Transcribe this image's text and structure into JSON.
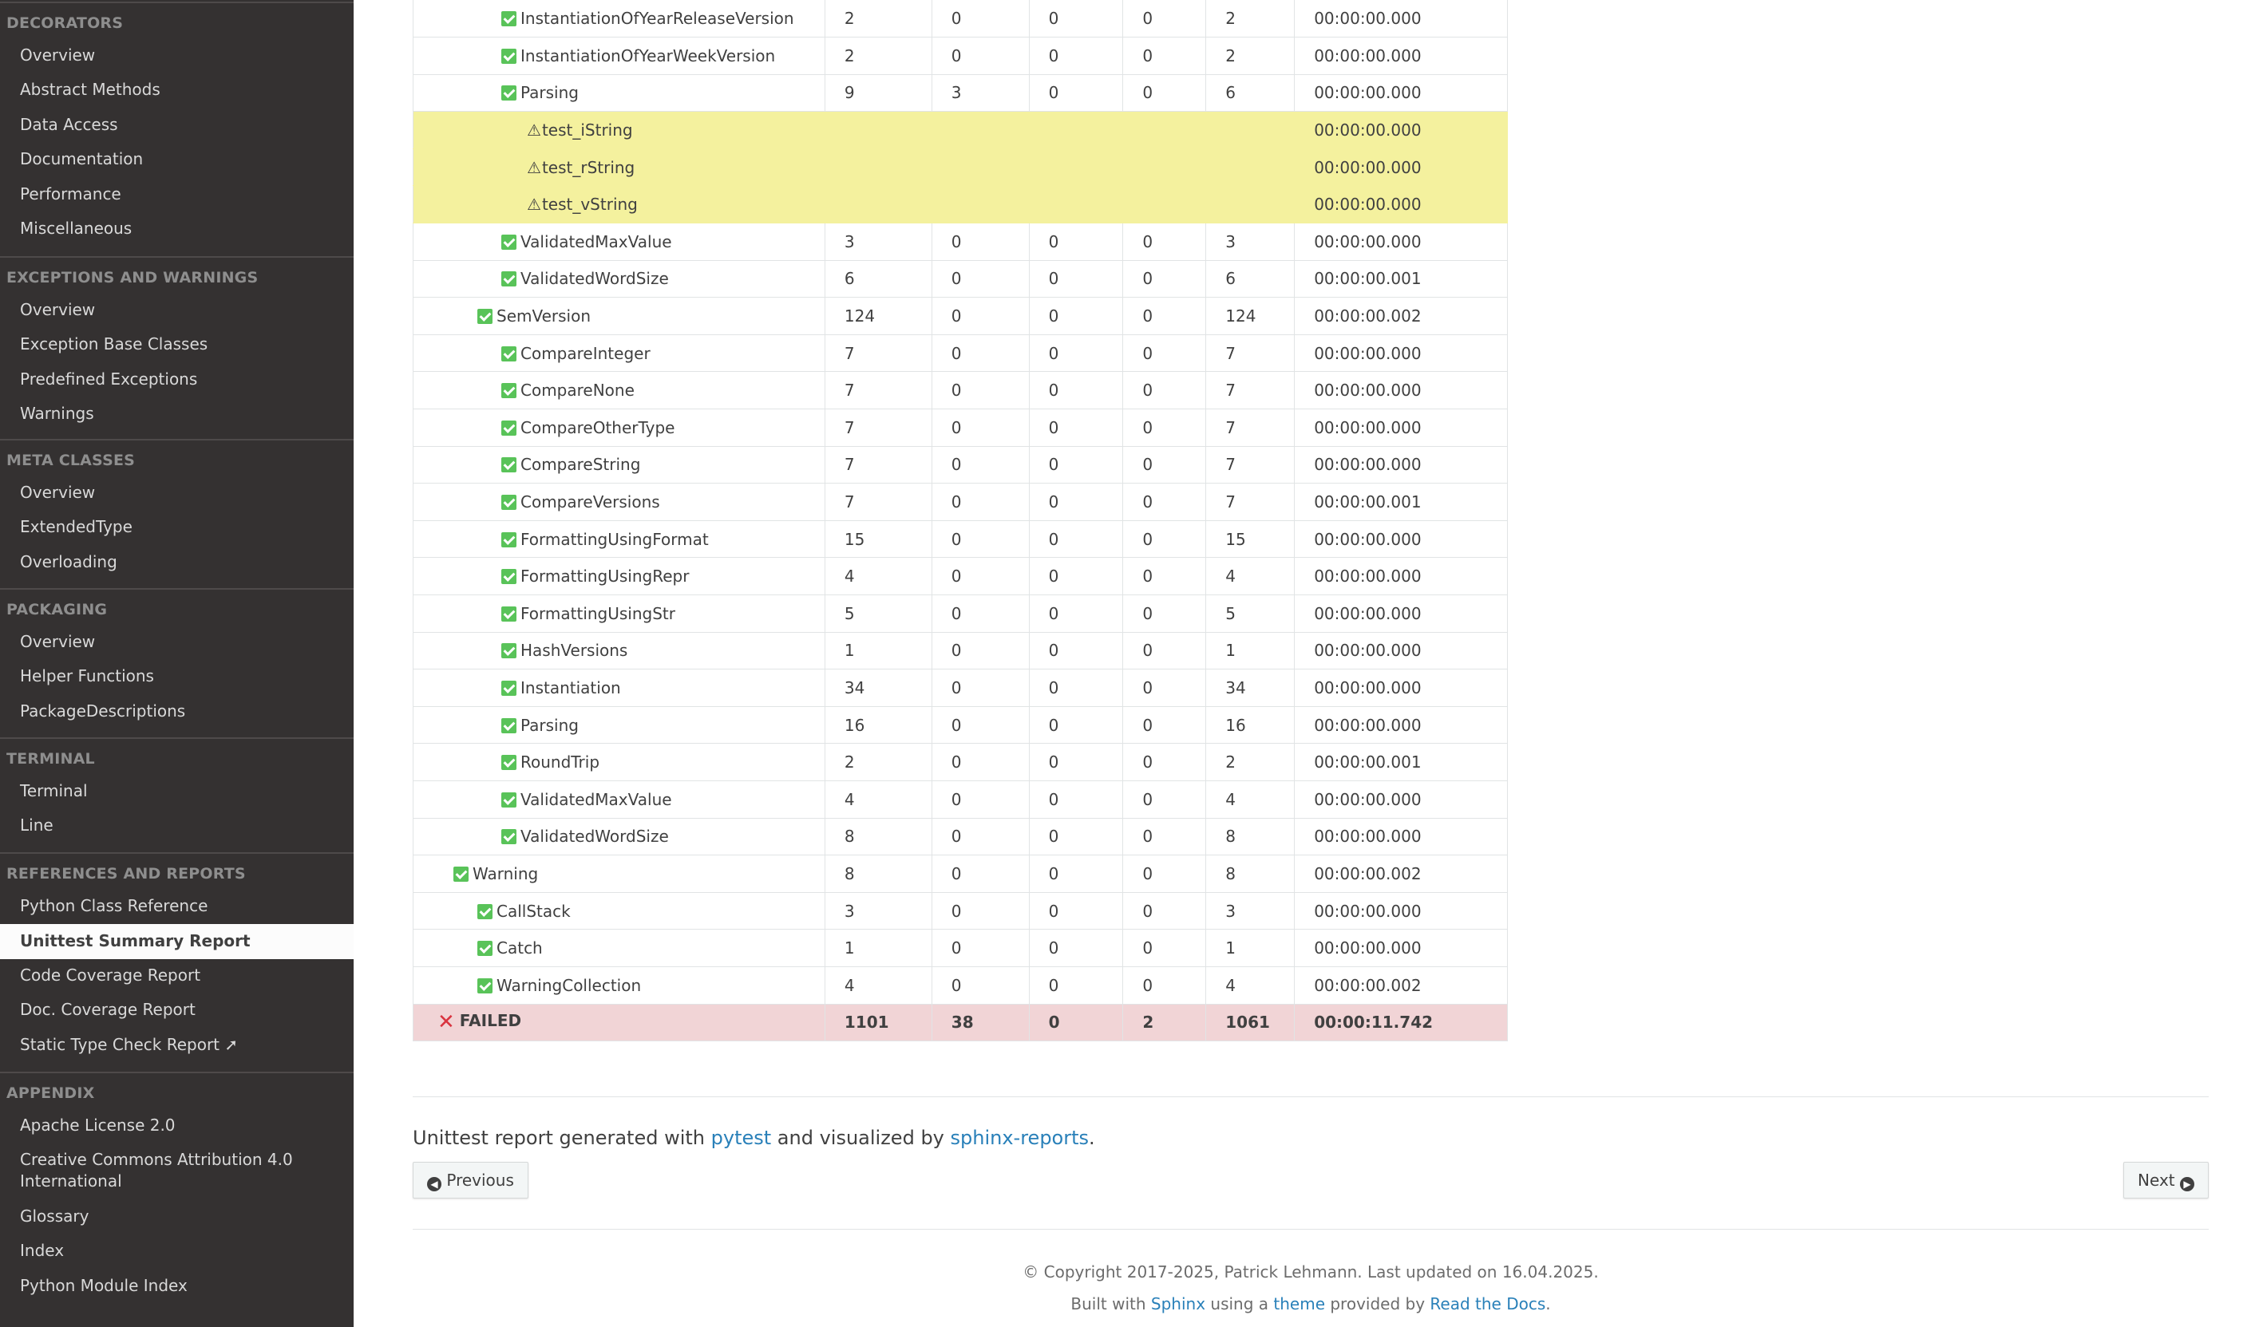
{
  "sidebar": {
    "sections": [
      {
        "caption": "DECORATORS",
        "items": [
          "Overview",
          "Abstract Methods",
          "Data Access",
          "Documentation",
          "Performance",
          "Miscellaneous"
        ]
      },
      {
        "caption": "EXCEPTIONS AND WARNINGS",
        "items": [
          "Overview",
          "Exception Base Classes",
          "Predefined Exceptions",
          "Warnings"
        ]
      },
      {
        "caption": "META CLASSES",
        "items": [
          "Overview",
          "ExtendedType",
          "Overloading"
        ]
      },
      {
        "caption": "PACKAGING",
        "items": [
          "Overview",
          "Helper Functions",
          "PackageDescriptions"
        ]
      },
      {
        "caption": "TERMINAL",
        "items": [
          "Terminal",
          "Line"
        ]
      },
      {
        "caption": "REFERENCES AND REPORTS",
        "items": [
          "Python Class Reference",
          "Unittest Summary Report",
          "Code Coverage Report",
          "Doc. Coverage Report",
          "Static Type Check Report ➚"
        ]
      },
      {
        "caption": "APPENDIX",
        "items": [
          "Apache License 2.0",
          "Creative Commons Attribution 4.0 International",
          "Glossary",
          "Index",
          "Python Module Index"
        ]
      }
    ],
    "current_item": "Unittest Summary Report"
  },
  "table": {
    "rows": [
      {
        "name": "InstantiationOfYearReleaseVersion",
        "status": "passed",
        "tests": "2",
        "skipped": "0",
        "errored": "0",
        "failed": "0",
        "passed": "2",
        "duration": "00:00:00.000"
      },
      {
        "name": "InstantiationOfYearWeekVersion",
        "status": "passed",
        "tests": "2",
        "skipped": "0",
        "errored": "0",
        "failed": "0",
        "passed": "2",
        "duration": "00:00:00.000"
      },
      {
        "name": "Parsing",
        "status": "passed",
        "tests": "9",
        "skipped": "3",
        "errored": "0",
        "failed": "0",
        "passed": "6",
        "duration": "00:00:00.000"
      },
      {
        "name": "test_iString",
        "status": "skipped",
        "tests": "",
        "skipped": "",
        "errored": "",
        "failed": "",
        "passed": "",
        "duration": "00:00:00.000"
      },
      {
        "name": "test_rString",
        "status": "skipped",
        "tests": "",
        "skipped": "",
        "errored": "",
        "failed": "",
        "passed": "",
        "duration": "00:00:00.000"
      },
      {
        "name": "test_vString",
        "status": "skipped",
        "tests": "",
        "skipped": "",
        "errored": "",
        "failed": "",
        "passed": "",
        "duration": "00:00:00.000"
      },
      {
        "name": "ValidatedMaxValue",
        "status": "passed",
        "tests": "3",
        "skipped": "0",
        "errored": "0",
        "failed": "0",
        "passed": "3",
        "duration": "00:00:00.000"
      },
      {
        "name": "ValidatedWordSize",
        "status": "passed",
        "tests": "6",
        "skipped": "0",
        "errored": "0",
        "failed": "0",
        "passed": "6",
        "duration": "00:00:00.001"
      },
      {
        "name": "SemVersion",
        "status": "passed",
        "tests": "124",
        "skipped": "0",
        "errored": "0",
        "failed": "0",
        "passed": "124",
        "duration": "00:00:00.002"
      },
      {
        "name": "CompareInteger",
        "status": "passed",
        "tests": "7",
        "skipped": "0",
        "errored": "0",
        "failed": "0",
        "passed": "7",
        "duration": "00:00:00.000"
      },
      {
        "name": "CompareNone",
        "status": "passed",
        "tests": "7",
        "skipped": "0",
        "errored": "0",
        "failed": "0",
        "passed": "7",
        "duration": "00:00:00.000"
      },
      {
        "name": "CompareOtherType",
        "status": "passed",
        "tests": "7",
        "skipped": "0",
        "errored": "0",
        "failed": "0",
        "passed": "7",
        "duration": "00:00:00.000"
      },
      {
        "name": "CompareString",
        "status": "passed",
        "tests": "7",
        "skipped": "0",
        "errored": "0",
        "failed": "0",
        "passed": "7",
        "duration": "00:00:00.000"
      },
      {
        "name": "CompareVersions",
        "status": "passed",
        "tests": "7",
        "skipped": "0",
        "errored": "0",
        "failed": "0",
        "passed": "7",
        "duration": "00:00:00.001"
      },
      {
        "name": "FormattingUsingFormat",
        "status": "passed",
        "tests": "15",
        "skipped": "0",
        "errored": "0",
        "failed": "0",
        "passed": "15",
        "duration": "00:00:00.000"
      },
      {
        "name": "FormattingUsingRepr",
        "status": "passed",
        "tests": "4",
        "skipped": "0",
        "errored": "0",
        "failed": "0",
        "passed": "4",
        "duration": "00:00:00.000"
      },
      {
        "name": "FormattingUsingStr",
        "status": "passed",
        "tests": "5",
        "skipped": "0",
        "errored": "0",
        "failed": "0",
        "passed": "5",
        "duration": "00:00:00.000"
      },
      {
        "name": "HashVersions",
        "status": "passed",
        "tests": "1",
        "skipped": "0",
        "errored": "0",
        "failed": "0",
        "passed": "1",
        "duration": "00:00:00.000"
      },
      {
        "name": "Instantiation",
        "status": "passed",
        "tests": "34",
        "skipped": "0",
        "errored": "0",
        "failed": "0",
        "passed": "34",
        "duration": "00:00:00.000"
      },
      {
        "name": "Parsing",
        "status": "passed",
        "tests": "16",
        "skipped": "0",
        "errored": "0",
        "failed": "0",
        "passed": "16",
        "duration": "00:00:00.000"
      },
      {
        "name": "RoundTrip",
        "status": "passed",
        "tests": "2",
        "skipped": "0",
        "errored": "0",
        "failed": "0",
        "passed": "2",
        "duration": "00:00:00.001"
      },
      {
        "name": "ValidatedMaxValue",
        "status": "passed",
        "tests": "4",
        "skipped": "0",
        "errored": "0",
        "failed": "0",
        "passed": "4",
        "duration": "00:00:00.000"
      },
      {
        "name": "ValidatedWordSize",
        "status": "passed",
        "tests": "8",
        "skipped": "0",
        "errored": "0",
        "failed": "0",
        "passed": "8",
        "duration": "00:00:00.000"
      },
      {
        "name": "Warning",
        "status": "passed",
        "tests": "8",
        "skipped": "0",
        "errored": "0",
        "failed": "0",
        "passed": "8",
        "duration": "00:00:00.002"
      },
      {
        "name": "CallStack",
        "status": "passed",
        "tests": "3",
        "skipped": "0",
        "errored": "0",
        "failed": "0",
        "passed": "3",
        "duration": "00:00:00.000"
      },
      {
        "name": "Catch",
        "status": "passed",
        "tests": "1",
        "skipped": "0",
        "errored": "0",
        "failed": "0",
        "passed": "1",
        "duration": "00:00:00.000"
      },
      {
        "name": "WarningCollection",
        "status": "passed",
        "tests": "4",
        "skipped": "0",
        "errored": "0",
        "failed": "0",
        "passed": "4",
        "duration": "00:00:00.002"
      },
      {
        "name": "FAILED",
        "status": "failed",
        "tests": "1101",
        "skipped": "38",
        "errored": "0",
        "failed": "2",
        "passed": "1061",
        "duration": "00:00:11.742"
      }
    ]
  },
  "report_line": {
    "prefix": "Unittest report generated with ",
    "link1": "pytest",
    "middle": " and visualized by ",
    "link2": "sphinx-reports",
    "suffix": "."
  },
  "nav": {
    "previous_label": "Previous",
    "next_label": "Next"
  },
  "footer": {
    "copyright": "© Copyright 2017-2025, Patrick Lehmann. Last updated on 16.04.2025.",
    "built_prefix": "Built with ",
    "built_link1": "Sphinx",
    "built_middle1": " using a ",
    "built_link2": "theme",
    "built_middle2": " provided by ",
    "built_link3": "Read the Docs",
    "built_suffix": "."
  },
  "colors": {
    "sidebar_bg": "#343131",
    "link": "#2980b9",
    "skipped_row": "#f4f19e",
    "failed_row": "#f1d4d6",
    "passed_check": "#59c359"
  }
}
